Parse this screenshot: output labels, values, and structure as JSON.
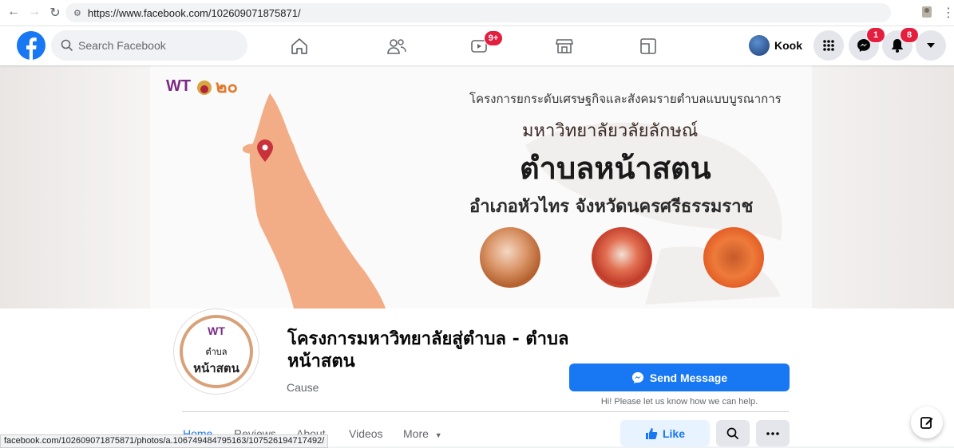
{
  "browser": {
    "url": "https://www.facebook.com/102609071875871/",
    "status_url": "facebook.com/102609071875871/photos/a.106749484795163/107526194717492/"
  },
  "header": {
    "search_placeholder": "Search Facebook",
    "watch_badge": "9+",
    "profile_name": "Kook",
    "messenger_badge": "1",
    "notifications_badge": "8"
  },
  "cover": {
    "line1": "โครงการยกระดับเศรษฐกิจและสังคมรายตำบลแบบบูรณาการ",
    "line2": "มหาวิทยาลัยวลัยลักษณ์",
    "line3": "ตำบลหน้าสตน",
    "line4": "อำเภอหัวไทร  จังหวัดนครศรีธรรมราช"
  },
  "profile_pic": {
    "top": "ตำบล",
    "bottom": "หน้าสตน"
  },
  "page": {
    "name": "โครงการมหาวิทยาลัยสู่ตำบล - ตำบลหน้าสตน",
    "category": "Cause",
    "send_message": "Send Message",
    "send_note": "Hi! Please let us know how we can help.",
    "like": "Like"
  },
  "tabs": [
    "Home",
    "Reviews",
    "About",
    "Videos",
    "More"
  ],
  "colors": {
    "fb_blue": "#1877f2",
    "badge_red": "#e41e3f"
  }
}
